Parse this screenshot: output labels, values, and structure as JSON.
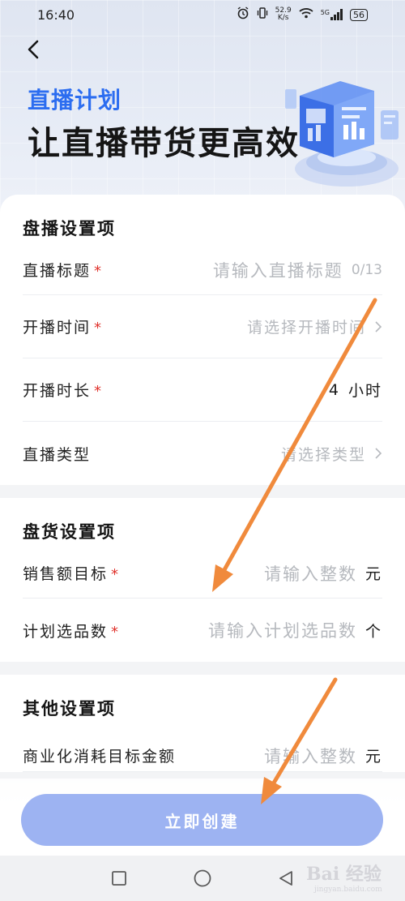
{
  "status_bar": {
    "time": "16:40",
    "net_speed_value": "52.9",
    "net_speed_unit": "K/s",
    "signal_label": "5G",
    "battery": "56"
  },
  "header": {
    "subtitle": "直播计划",
    "title": "让直播带货更高效"
  },
  "sections": {
    "broadcast": {
      "title": "盘播设置项",
      "title_field": {
        "label": "直播标题",
        "required": "*",
        "placeholder": "请输入直播标题",
        "counter": "0/13"
      },
      "start_time": {
        "label": "开播时间",
        "required": "*",
        "placeholder": "请选择开播时间"
      },
      "duration": {
        "label": "开播时长",
        "required": "*",
        "value": "4",
        "unit": "小时"
      },
      "type": {
        "label": "直播类型",
        "placeholder": "请选择类型"
      }
    },
    "goods": {
      "title": "盘货设置项",
      "sales_target": {
        "label": "销售额目标",
        "required": "*",
        "placeholder": "请输入整数",
        "unit": "元"
      },
      "item_count": {
        "label": "计划选品数",
        "required": "*",
        "placeholder": "请输入计划选品数",
        "unit": "个"
      }
    },
    "other": {
      "title": "其他设置项",
      "partial_row": {
        "label": "商业化消耗目标金额",
        "placeholder": "请输入整数",
        "unit": "元"
      }
    }
  },
  "create_button": {
    "label": "立即创建"
  },
  "watermark": {
    "main": "Bai 经验",
    "sub": "jingyan.baidu.com"
  },
  "colors": {
    "accent_blue": "#2c6df0",
    "button_blue": "#9db3f2",
    "required_red": "#e0332d",
    "annotation_orange": "#f08a3c"
  }
}
